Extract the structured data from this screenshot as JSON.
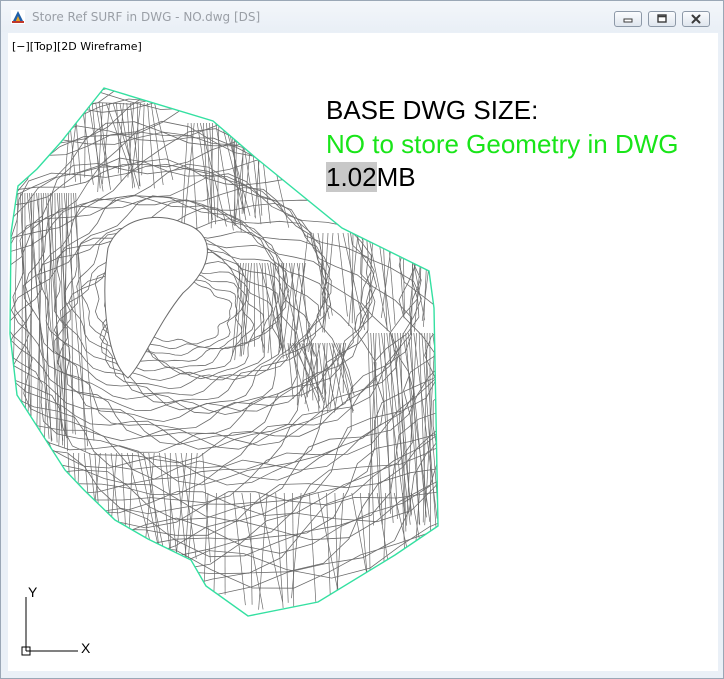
{
  "window": {
    "title": "Store Ref SURF in DWG - NO.dwg [DS]",
    "icons": {
      "app": "autocad-app-icon",
      "minimize": "minimize-icon",
      "maximize": "maximize-icon",
      "close": "close-icon"
    }
  },
  "viewport": {
    "label": "[−][Top][2D Wireframe]"
  },
  "annotation": {
    "line1": "BASE DWG SIZE:",
    "line2": "NO to store Geometry  in DWG",
    "size_selected": "1.02",
    "size_rest": "MB"
  },
  "ucs": {
    "y_label": "Y",
    "x_label": "X"
  },
  "colors": {
    "boundary": "#34e0a1",
    "contours": "#6b6b6b",
    "annotation_green": "#19e519",
    "selection": "#c8c8c8"
  }
}
